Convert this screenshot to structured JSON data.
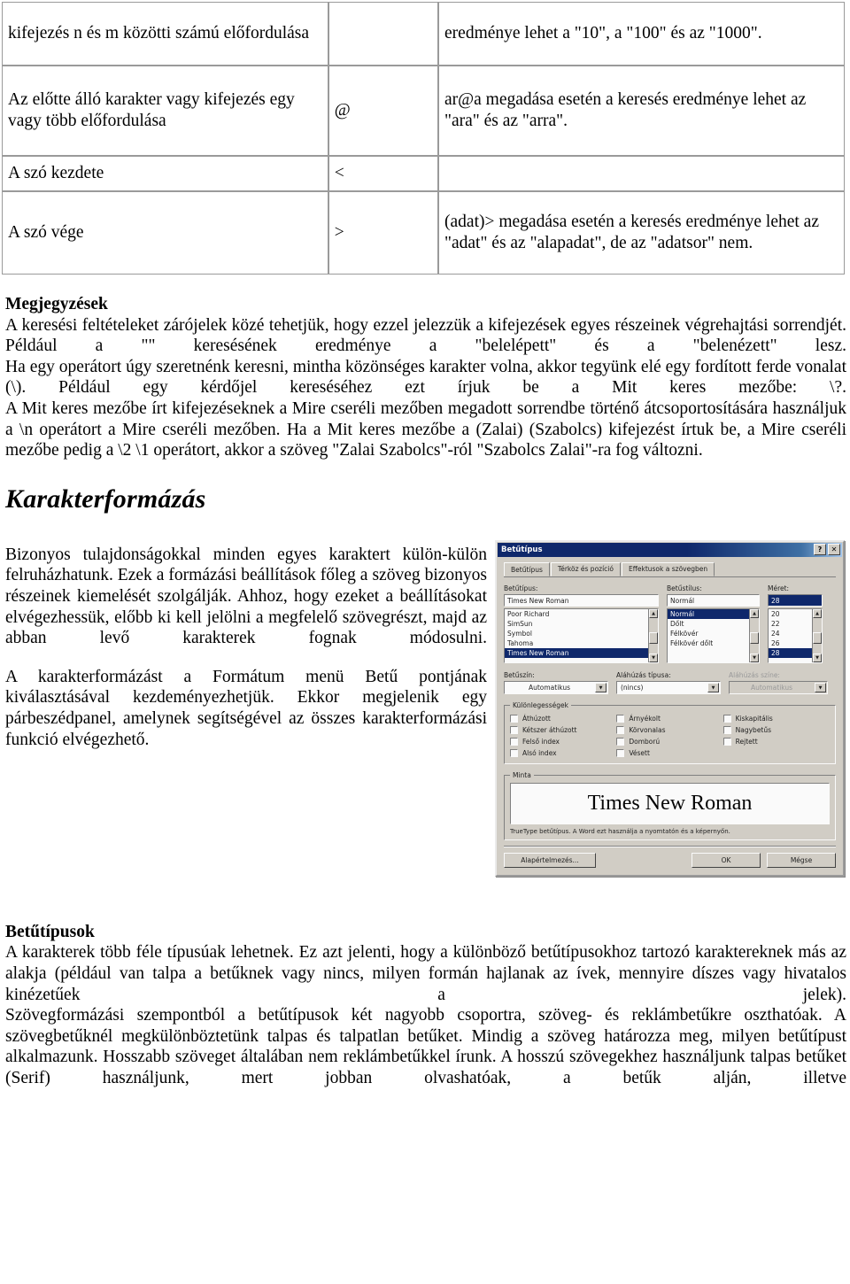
{
  "operator_table": {
    "rows": [
      {
        "description": "kifejezés n és m közötti számú előfordulása",
        "operator": "",
        "example": "eredménye lehet a \"10\", a \"100\" és az \"1000\"."
      },
      {
        "description": "Az előtte álló karakter vagy kifejezés egy vagy több előfordulása",
        "operator": "@",
        "example": "ar@a megadása esetén a keresés eredménye lehet az \"ara\" és az \"arra\"."
      },
      {
        "description": "A szó kezdete",
        "operator": "<",
        "example": ""
      },
      {
        "description": "A szó vége",
        "operator": ">",
        "example": "(adat)> megadása esetén a keresés eredménye lehet az \"adat\" és az \"alapadat\", de az \"adatsor\" nem."
      }
    ]
  },
  "notes": {
    "heading": "Megjegyzések",
    "paragraphs": [
      "A keresési feltételeket zárójelek közé tehetjük, hogy ezzel jelezzük a kifejezések egyes részeinek végrehajtási sorrendjét. Például a \"\" keresésének eredménye a \"belelépett\" és a \"belenézett\" lesz.",
      "Ha egy operátort úgy szeretnénk keresni, mintha közönséges karakter volna, akkor tegyünk elé egy fordított ferde vonalat (\\). Például egy kérdőjel kereséséhez ezt írjuk be a Mit keres mezőbe: \\?.",
      "A Mit keres mezőbe írt kifejezéseknek a Mire cseréli mezőben megadott sorrendbe történő átcsoportosítására használjuk a \\n operátort a Mire cseréli mezőben. Ha a Mit keres mezőbe a (Zalai) (Szabolcs) kifejezést írtuk be, a Mire cseréli mezőbe pedig a \\2 \\1 operátort, akkor a szöveg \"Zalai Szabolcs\"-ról \"Szabolcs Zalai\"-ra fog változni."
    ]
  },
  "section": {
    "title": "Karakterformázás",
    "paragraph_1": "Bizonyos tulajdonságokkal minden egyes karaktert külön-külön felruházhatunk. Ezek a formázási beállítások főleg a szöveg bizonyos részeinek kiemelését szolgálják. Ahhoz, hogy ezeket a beállításokat elvégezhessük, előbb ki kell jelölni a megfelelő szövegrészt, majd az abban levő karakterek fognak módosulni.",
    "paragraph_2": "A karakterformázást a Formátum menü Betű pontjának kiválasztásával kezdeményezhetjük. Ekkor megjelenik egy párbeszédpanel, amelynek segítségével az összes karakterformázási funkció elvégezhető."
  },
  "fonts_section": {
    "heading": "Betűtípusok",
    "paragraph_1": "A karakterek több féle típusúak lehetnek. Ez azt jelenti, hogy a különböző betűtípusokhoz tartozó karaktereknek más az alakja (például van talpa a betűknek vagy nincs, milyen formán hajlanak az ívek, mennyire díszes vagy hivatalos kinézetűek a jelek).",
    "paragraph_2": "Szövegformázási szempontból a betűtípusok két nagyobb csoportra, szöveg- és reklámbetűkre oszthatóak. A szövegbetűknél megkülönböztetünk talpas és talpatlan betűket. Mindig a szöveg határozza meg, milyen betűtípust alkalmazunk. Hosszabb szöveget általában nem reklámbetűkkel írunk. A hosszú szövegekhez használjunk talpas betűket (Serif) használjunk, mert jobban olvashatóak, a betűk alján, illetve"
  },
  "font_dialog": {
    "title": "Betűtípus",
    "help_button": "?",
    "close_button": "✕",
    "tabs": [
      {
        "label": "Betűtípus",
        "active": true
      },
      {
        "label": "Térköz és pozíció",
        "active": false
      },
      {
        "label": "Effektusok a szövegben",
        "active": false
      }
    ],
    "font": {
      "label": "Betűtípus:",
      "value": "Times New Roman",
      "options": [
        "Poor Richard",
        "SimSun",
        "Symbol",
        "Tahoma",
        "Times New Roman"
      ],
      "selected": "Times New Roman"
    },
    "style": {
      "label": "Betűstílus:",
      "value": "Normál",
      "options": [
        "Normál",
        "Dőlt",
        "Félkövér",
        "Félkövér dőlt"
      ],
      "selected": "Normál"
    },
    "size": {
      "label": "Méret:",
      "value": "28",
      "options": [
        "20",
        "22",
        "24",
        "26",
        "28"
      ],
      "selected": "28"
    },
    "color": {
      "label": "Betűszín:",
      "value": "Automatikus"
    },
    "underline_style": {
      "label": "Aláhúzás típusa:",
      "value": "(nincs)"
    },
    "underline_color": {
      "label": "Aláhúzás színe:",
      "value": "Automatikus"
    },
    "effects": {
      "legend": "Különlegességek",
      "column1": [
        "Áthúzott",
        "Kétszer áthúzott",
        "Felső index",
        "Alsó index"
      ],
      "column2": [
        "Árnyékolt",
        "Körvonalas",
        "Domború",
        "Vésett"
      ],
      "column3": [
        "Kiskapitális",
        "Nagybetűs",
        "Rejtett"
      ]
    },
    "preview": {
      "legend": "Minta",
      "text": "Times New Roman",
      "note": "TrueType betűtípus. A Word ezt használja a nyomtatón és a képernyőn."
    },
    "buttons": {
      "default": "Alapértelmezés...",
      "ok": "OK",
      "cancel": "Mégse"
    },
    "colors": {
      "titlebar": "#0a246a",
      "face": "#d4d0c8",
      "highlight": "#0a246a"
    }
  }
}
